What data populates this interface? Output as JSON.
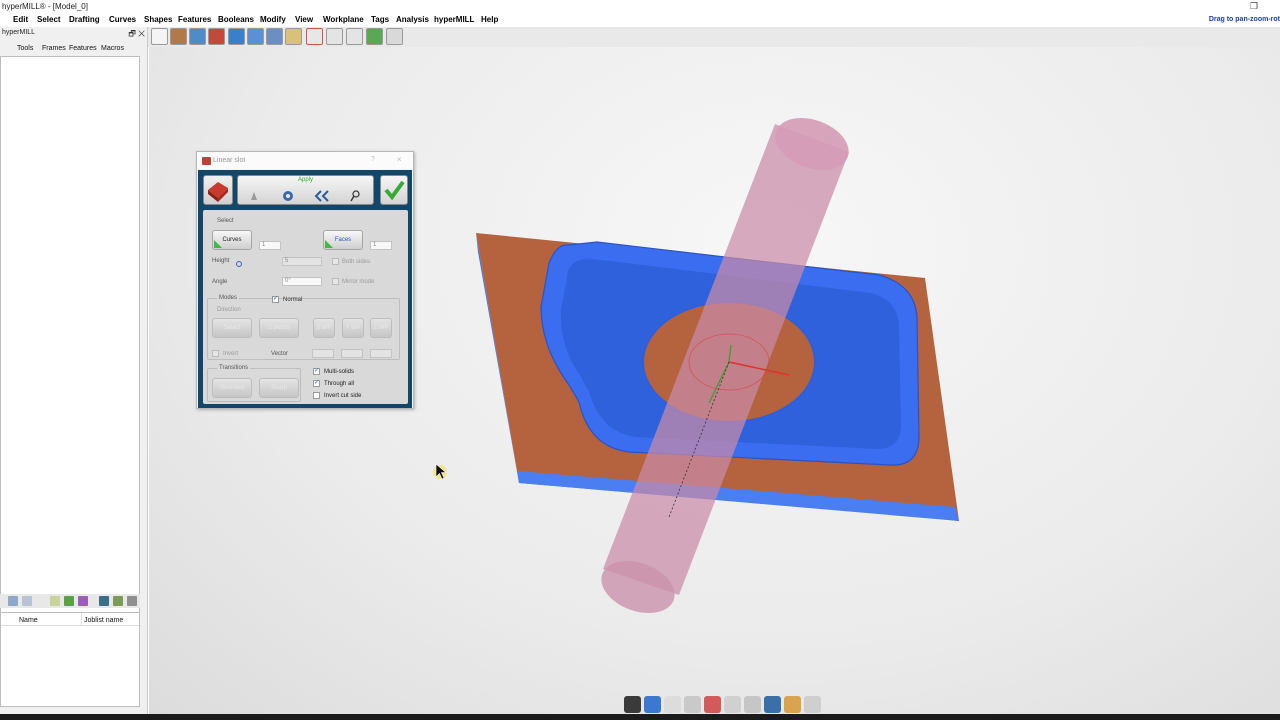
{
  "window": {
    "title": "hyperMILL® - [Model_0]"
  },
  "menu": {
    "items": [
      "Edit",
      "Select",
      "Drafting",
      "Curves",
      "Shapes",
      "Features",
      "Booleans",
      "Modify",
      "View",
      "Workplane",
      "Tags",
      "Analysis",
      "hyperMILL",
      "Help"
    ],
    "hint": "Drag to pan-zoom-rot"
  },
  "left_panel": {
    "title": "hyperMILL",
    "tabs": [
      "Tools",
      "Frames",
      "Features",
      "Macros"
    ],
    "list_headers": [
      "Name",
      "Joblist name"
    ]
  },
  "dialog": {
    "title": "Linear slot",
    "help": "?",
    "close": "×",
    "apply": "Apply",
    "select_label": "Select",
    "curves_label": "Curves",
    "curves_count": "1",
    "faces_label": "Faces",
    "faces_count": "1",
    "height_label": "Height",
    "height_value": "5",
    "both_sides_label": "Both sides",
    "angle_label": "Angle",
    "angle_value": "0°",
    "mirror_label": "Mirror mode",
    "modes_label": "Modes",
    "normal_label": "Normal",
    "direction_label": "Direction",
    "select_btn": "Select",
    "two_points_btn": "2 points",
    "x_wp": "X WP",
    "y_wp": "Y WP",
    "z_wp": "Z WP",
    "invert_label": "Invert",
    "vector_label": "Vector",
    "transitions_label": "Transitions",
    "rounded_btn": "Rounded",
    "sharp_btn": "Sharp",
    "multi_solids_label": "Multi-solids",
    "multi_solids_checked": true,
    "through_all_label": "Through all",
    "through_all_checked": true,
    "invert_cut_label": "Invert cut side",
    "invert_cut_checked": false
  },
  "colors": {
    "plate_top": "#b5623f",
    "plate_side": "#3f75e6",
    "pocket_blue": "#3a6df0",
    "cylinder": "#c98aa8",
    "dialog_frame": "#13476a",
    "apply_green": "#2fa52f",
    "menu_hint": "#1e3fb0"
  }
}
